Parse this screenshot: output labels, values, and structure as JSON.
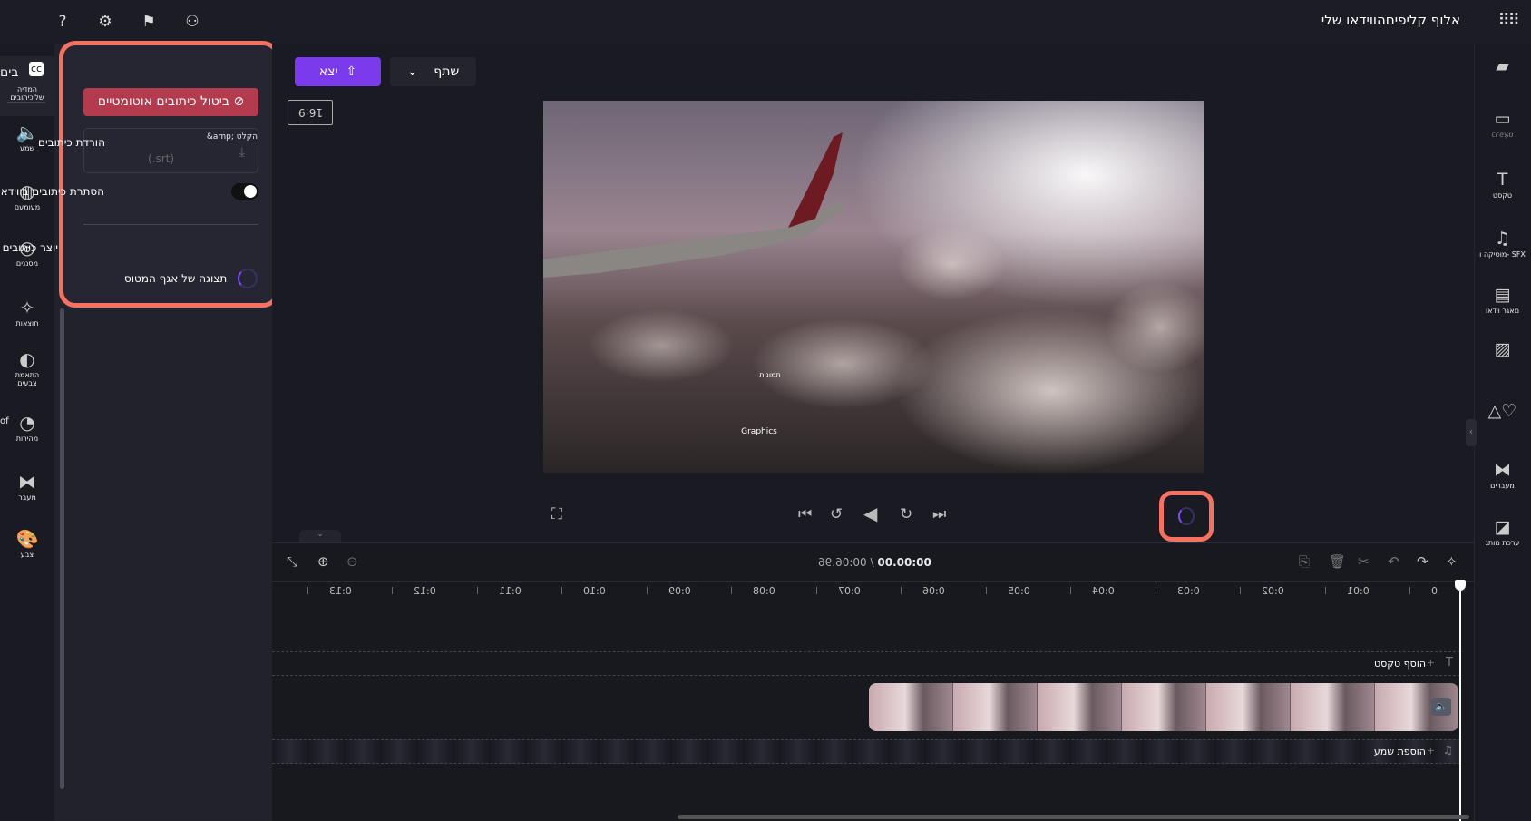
{
  "topbar": {
    "title": "אלוף קליפיםהווידאו שלי",
    "icons": [
      "help-icon",
      "gear-icon",
      "feedback-icon",
      "account-icon"
    ],
    "apps_icon": "grid-icon"
  },
  "left_rail": {
    "items": [
      {
        "label": "המדיה שליכיתובים",
        "top_text": "בים",
        "icon": "cc-icon"
      },
      {
        "label": "שמע",
        "icon": "speaker-icon"
      },
      {
        "label": "מעומעם",
        "icon": "fade-icon"
      },
      {
        "label": "מסננים",
        "icon": "filter-icon"
      },
      {
        "label": "תוצאות",
        "icon": "magic-wand-icon"
      },
      {
        "label": "התאמת צבעים",
        "icon": "contrast-icon"
      },
      {
        "label": "מהירות",
        "icon": "speedometer-icon",
        "side_text": "of"
      },
      {
        "label": "מעבר",
        "icon": "transition-icon"
      },
      {
        "label": "צבע",
        "icon": "palette-icon"
      }
    ]
  },
  "captions_panel": {
    "auto_captions_button": "ביטול כיתובים אוטומטיים",
    "download_label": "הורדת כיתובים",
    "download_sub": "&amp; הקלט",
    "download_format": "(.srt)",
    "hide_captions_label": "הסתרת כיתובים בווידאו",
    "hide_captions_on": true,
    "caption_creator_label": "יוצר כיתובים",
    "waveform_label": "תצוגה של אגף המטוס"
  },
  "toolbar": {
    "export_label": "יצא",
    "share_label": "שתף",
    "aspect_ratio": "16:9"
  },
  "preview": {
    "overlay_text_1": "תמונות",
    "overlay_text_2": "Graphics"
  },
  "timeline": {
    "current_time": "00.00:00",
    "total_time": "00:06.96",
    "ruler": [
      "0",
      "0:01",
      "0:02",
      "0:03",
      "0:04",
      "0:05",
      "0:06",
      "0:07",
      "0:08",
      "0:09",
      "0:10",
      "0:11",
      "0:12",
      "0:13"
    ],
    "add_text": "הוסף טקסט",
    "add_audio": "הוספת שמע"
  },
  "right_rail": {
    "items": [
      {
        "label": "",
        "icon": "folder-icon"
      },
      {
        "label": "כרפּאֶטּ",
        "icon": "camera-icon"
      },
      {
        "label": "טקסט",
        "icon": "text-icon"
      },
      {
        "label": "מוסיקה ו- SFX",
        "icon": "music-icon"
      },
      {
        "label": "מאגר וידאו",
        "icon": "film-icon"
      },
      {
        "label": "",
        "icon": "image-icon"
      },
      {
        "label": "",
        "icon": "shapes-icon"
      },
      {
        "label": "מעברים",
        "icon": "transition-icon"
      },
      {
        "label": "ערכת מותג",
        "icon": "brand-kit-icon"
      }
    ]
  },
  "colors": {
    "accent": "#7c3aed",
    "highlight": "#f87060",
    "danger": "#b23c4e"
  }
}
